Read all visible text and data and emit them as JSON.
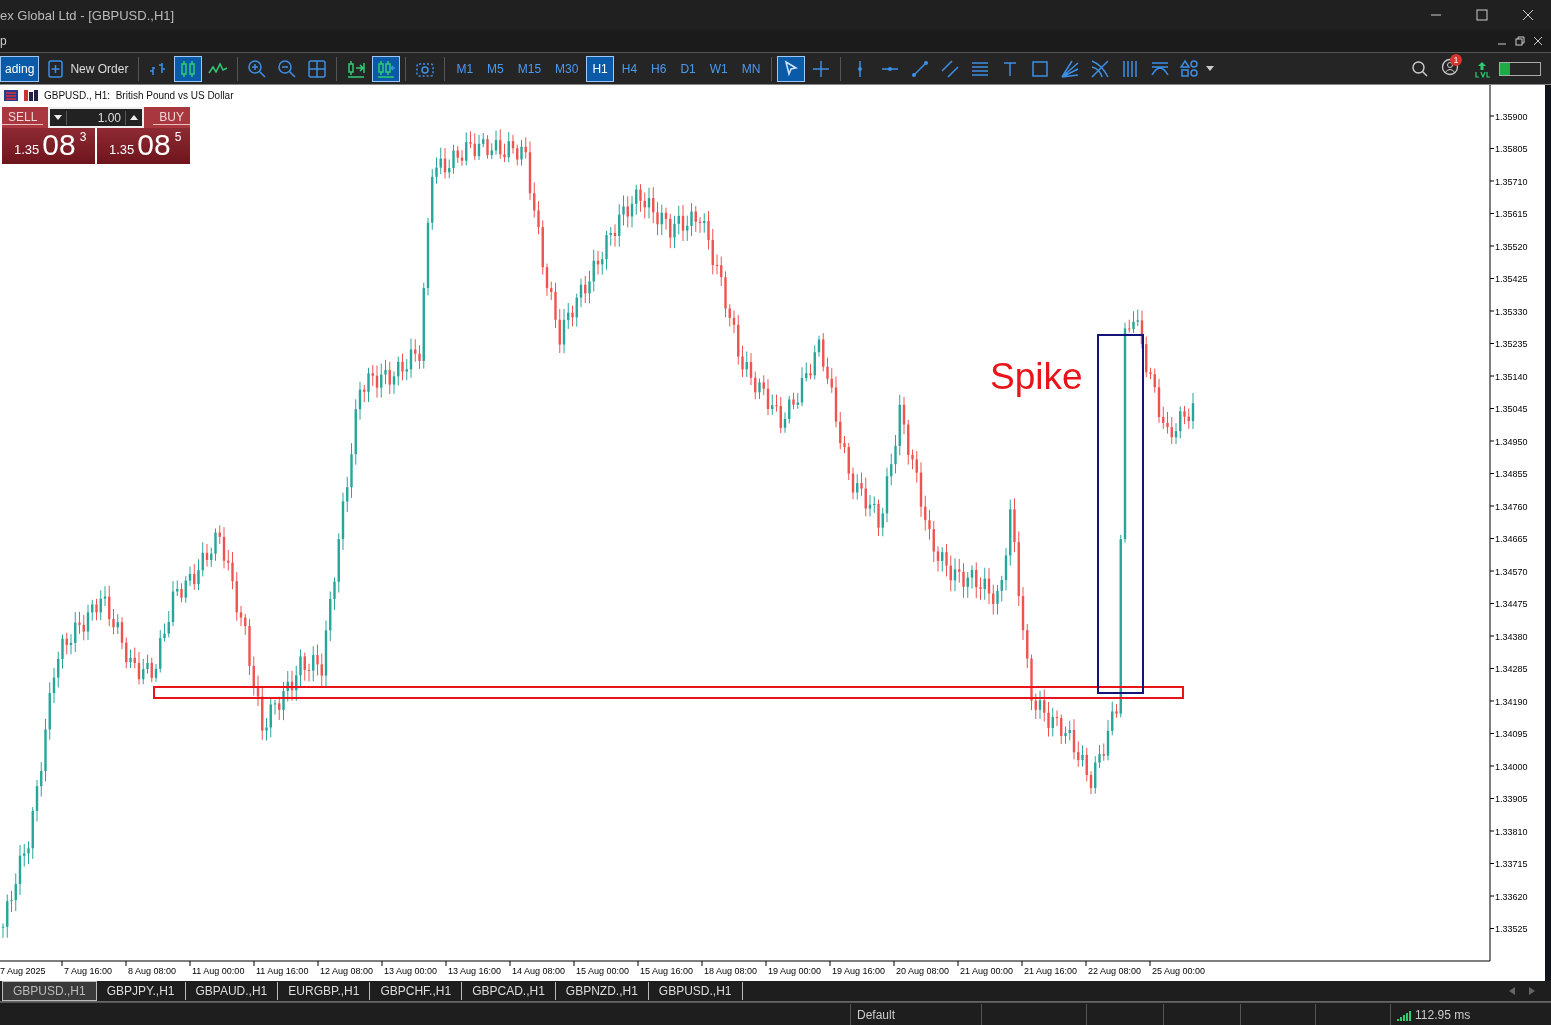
{
  "window": {
    "title": "ex Global Ltd - [GBPUSD.,H1]"
  },
  "menu": {
    "items": [
      "p"
    ]
  },
  "toolbar": {
    "left_buttons": [
      {
        "kind": "trading",
        "label": "ading",
        "selected": true
      },
      {
        "kind": "new-order",
        "label": "New Order",
        "selected": false
      }
    ],
    "chart_tools": [
      {
        "kind": "bars",
        "selected": false
      },
      {
        "kind": "candles",
        "selected": true
      },
      {
        "kind": "line",
        "selected": false
      },
      {
        "kind": "zoom-in",
        "selected": false
      },
      {
        "kind": "zoom-out",
        "selected": false
      },
      {
        "kind": "tile",
        "selected": false
      },
      {
        "kind": "autoscroll",
        "selected": false
      },
      {
        "kind": "shift",
        "selected": true
      },
      {
        "kind": "screenshot",
        "selected": false
      }
    ],
    "timeframes": [
      {
        "label": "M1",
        "selected": false
      },
      {
        "label": "M5",
        "selected": false
      },
      {
        "label": "M15",
        "selected": false
      },
      {
        "label": "M30",
        "selected": false
      },
      {
        "label": "H1",
        "selected": true
      },
      {
        "label": "H4",
        "selected": false
      },
      {
        "label": "H6",
        "selected": false
      },
      {
        "label": "D1",
        "selected": false
      },
      {
        "label": "W1",
        "selected": false
      },
      {
        "label": "MN",
        "selected": false
      }
    ],
    "draw_tools": [
      {
        "kind": "cursor",
        "selected": true
      },
      {
        "kind": "crosshair",
        "selected": false
      },
      {
        "kind": "vline",
        "selected": false
      },
      {
        "kind": "hline",
        "selected": false
      },
      {
        "kind": "trendline",
        "selected": false
      },
      {
        "kind": "channel",
        "selected": false
      },
      {
        "kind": "fibo",
        "selected": false
      },
      {
        "kind": "text",
        "selected": false
      },
      {
        "kind": "rect",
        "selected": false
      },
      {
        "kind": "fan",
        "selected": false
      },
      {
        "kind": "arcs",
        "selected": false
      },
      {
        "kind": "cycles",
        "selected": false
      },
      {
        "kind": "pitch",
        "selected": false
      },
      {
        "kind": "shapes",
        "selected": false
      }
    ],
    "notification_count": "1"
  },
  "chart": {
    "header": "GBPUSD., H1:  British Pound vs US Dollar",
    "trade_panel": {
      "sell_label": "SELL",
      "buy_label": "BUY",
      "volume": "1.00",
      "sell_price": {
        "big": "1.35",
        "main": "08",
        "small": "3"
      },
      "buy_price": {
        "big": "1.35",
        "main": "08",
        "small": "5"
      }
    },
    "annotation": "Spike",
    "price_labels": [
      "1.35900",
      "1.35805",
      "1.35710",
      "1.35615",
      "1.35520",
      "1.35425",
      "1.35330",
      "1.35235",
      "1.35140",
      "1.35045",
      "1.34950",
      "1.34855",
      "1.34760",
      "1.34665",
      "1.34570",
      "1.34475",
      "1.34380",
      "1.34285",
      "1.34190",
      "1.34095",
      "1.34000",
      "1.33905",
      "1.33810",
      "1.33715",
      "1.33620",
      "1.33525"
    ],
    "time_labels": [
      "7 Aug 2025",
      "7 Aug 16:00",
      "8 Aug 08:00",
      "11 Aug 00:00",
      "11 Aug 16:00",
      "12 Aug 08:00",
      "13 Aug 00:00",
      "13 Aug 16:00",
      "14 Aug 08:00",
      "15 Aug 00:00",
      "15 Aug 16:00",
      "18 Aug 08:00",
      "19 Aug 00:00",
      "19 Aug 16:00",
      "20 Aug 08:00",
      "21 Aug 00:00",
      "21 Aug 16:00",
      "22 Aug 08:00",
      "25 Aug 00:00"
    ]
  },
  "symbol_tabs": [
    {
      "label": "GBPUSD.,H1",
      "selected": true
    },
    {
      "label": "GBPJPY.,H1",
      "selected": false
    },
    {
      "label": "GBPAUD.,H1",
      "selected": false
    },
    {
      "label": "EURGBP.,H1",
      "selected": false
    },
    {
      "label": "GBPCHF.,H1",
      "selected": false
    },
    {
      "label": "GBPCAD.,H1",
      "selected": false
    },
    {
      "label": "GBPNZD.,H1",
      "selected": false
    },
    {
      "label": "GBPUSD.,H1",
      "selected": false
    }
  ],
  "status_bar": {
    "profile": "Default",
    "ping": "112.95 ms"
  }
}
